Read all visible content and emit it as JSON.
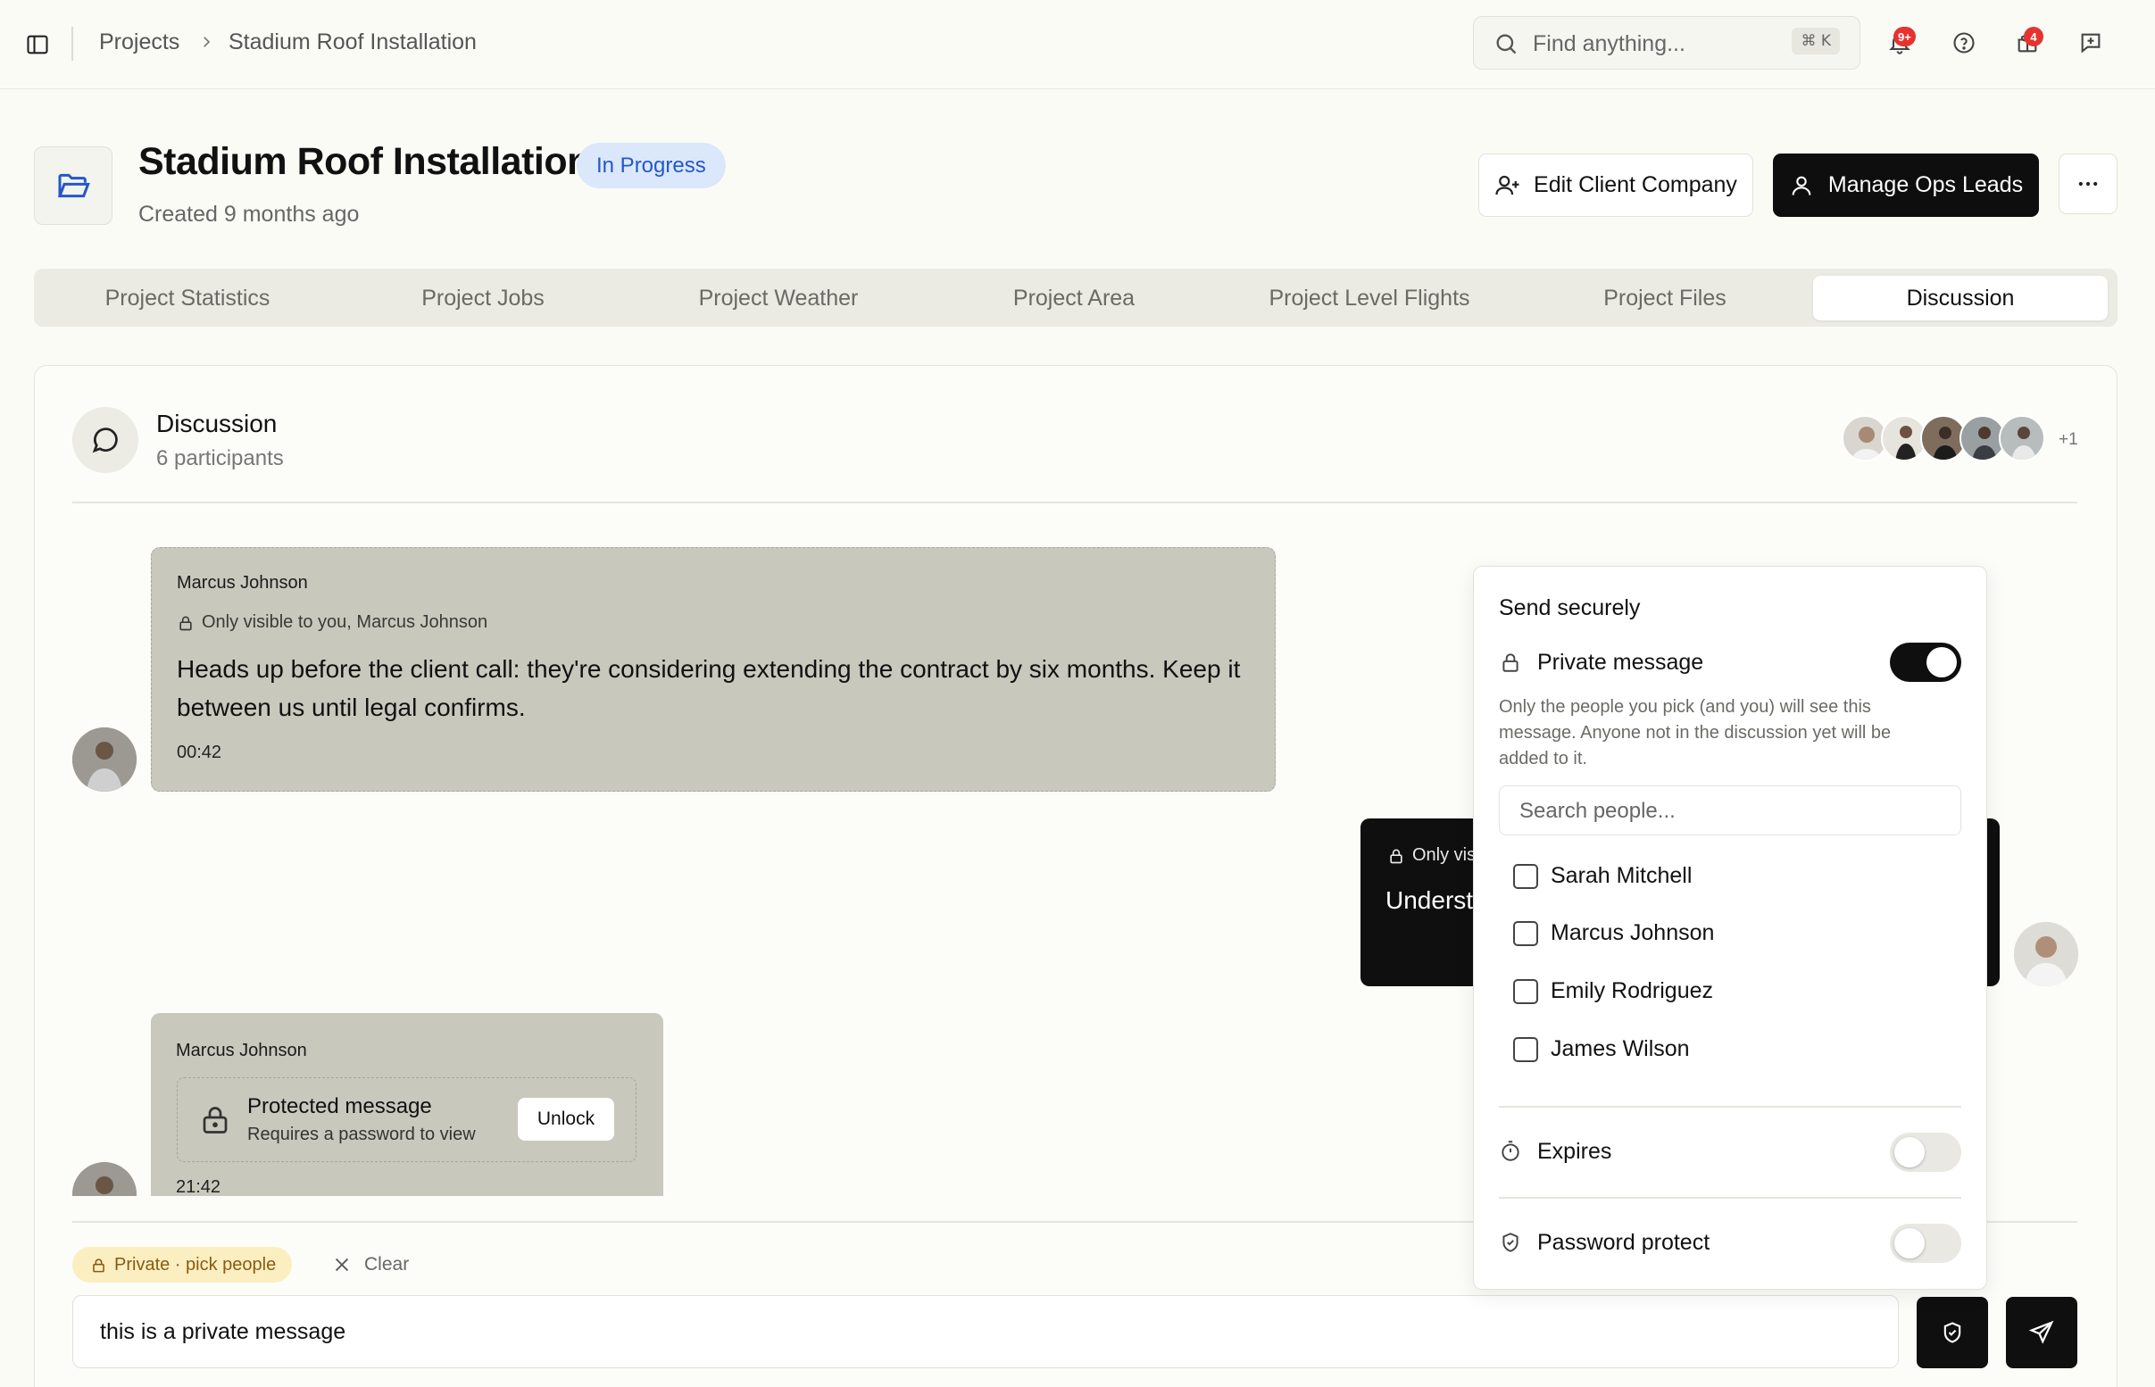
{
  "topbar": {
    "breadcrumbs": [
      "Projects",
      "Stadium Roof Installation"
    ],
    "search_placeholder": "Find anything...",
    "search_shortcut": "⌘ K",
    "notifications_badge": "9+",
    "updates_badge": "4"
  },
  "header": {
    "title": "Stadium Roof Installation",
    "status": "In Progress",
    "created": "Created 9 months ago",
    "edit_client_label": "Edit Client Company",
    "manage_ops_label": "Manage Ops Leads"
  },
  "tabs": [
    {
      "label": "Project Statistics",
      "active": false
    },
    {
      "label": "Project Jobs",
      "active": false
    },
    {
      "label": "Project Weather",
      "active": false
    },
    {
      "label": "Project Area",
      "active": false
    },
    {
      "label": "Project Level Flights",
      "active": false
    },
    {
      "label": "Project Files",
      "active": false
    },
    {
      "label": "Discussion",
      "active": true
    }
  ],
  "discussion": {
    "title": "Discussion",
    "participants": "6 participants",
    "more_participants": "+1"
  },
  "messages": [
    {
      "author": "Marcus Johnson",
      "visibility": "Only visible to you, Marcus Johnson",
      "body": "Heads up before the client call: they're considering extending the contract by six months. Keep it between us until legal confirms.",
      "time": "00:42"
    },
    {
      "visibility_partial": "Only vis",
      "body_partial": "Underst"
    },
    {
      "author": "Marcus Johnson",
      "protected_title": "Protected message",
      "protected_sub": "Requires a password to view",
      "unlock_label": "Unlock",
      "time": "21:42"
    }
  ],
  "composer": {
    "private_pill": "Private · pick people",
    "clear_label": "Clear",
    "text": "this is a private message"
  },
  "popover": {
    "title": "Send securely",
    "private_label": "Private message",
    "private_on": true,
    "help": "Only the people you pick (and you) will see this message. Anyone not in the discussion yet will be added to it.",
    "search_placeholder": "Search people...",
    "people": [
      "Sarah Mitchell",
      "Marcus Johnson",
      "Emily Rodriguez",
      "James Wilson"
    ],
    "expires_label": "Expires",
    "expires_on": false,
    "password_label": "Password protect",
    "password_on": false
  },
  "colors": {
    "background": "#fbfbf6",
    "accent_dark": "#0f0f0f",
    "status_bg": "#dbe7fb",
    "status_text": "#2458c9",
    "private_pill_bg": "#fbefc1",
    "badge_red": "#e5332f"
  }
}
